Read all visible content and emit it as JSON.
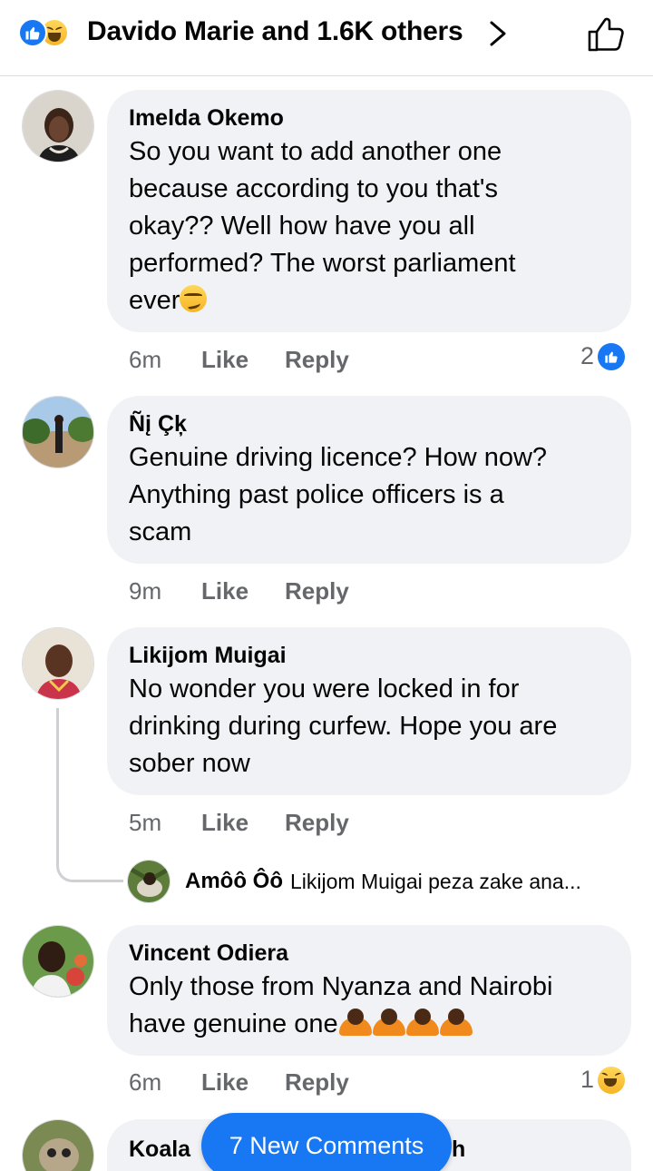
{
  "header": {
    "title": "Davido Marie and 1.6K others",
    "reaction_icons": [
      "like-icon",
      "haha-icon"
    ],
    "chevron_icon": "chevron-right-icon",
    "like_button_icon": "thumbs-up-outline-icon"
  },
  "comments": [
    {
      "author": "Imelda Okemo",
      "lines": [
        "So you want to add another one",
        "because according to you that's",
        "okay?? Well how have you all",
        "performed? The worst parliament",
        "ever"
      ],
      "emoji": "smirk-emoji",
      "time": "6m",
      "like_label": "Like",
      "reply_label": "Reply",
      "reaction_count": "2",
      "reaction_icon": "like-icon"
    },
    {
      "author": "Ñį Çķ",
      "lines": [
        "Genuine driving licence? How now?",
        "Anything past police officers is a",
        "scam"
      ],
      "time": "9m",
      "like_label": "Like",
      "reply_label": "Reply"
    },
    {
      "author": "Likijom Muigai",
      "lines": [
        "No wonder you were locked in for",
        "drinking during curfew. Hope you are",
        "sober now"
      ],
      "time": "5m",
      "like_label": "Like",
      "reply_label": "Reply",
      "reply_preview": {
        "author": "Amôô Ôô",
        "text": "Likijom Muigai peza zake ana..."
      }
    },
    {
      "author": "Vincent Odiera",
      "lines": [
        "Only those from Nyanza and Nairobi",
        "have genuine one"
      ],
      "emoji": "bowing-person-emoji",
      "time": "6m",
      "like_label": "Like",
      "reply_label": "Reply",
      "reaction_count": "1",
      "reaction_icon": "haha-icon"
    },
    {
      "author": "Koala",
      "author_tail": "h"
    }
  ],
  "new_comments_pill": "7 New Comments",
  "colors": {
    "accent": "#1877f2",
    "bubble": "#f0f2f5",
    "meta_text": "#65676b"
  }
}
